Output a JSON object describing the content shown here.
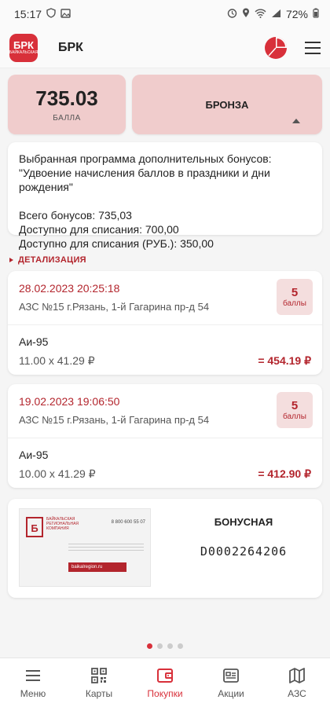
{
  "status_bar": {
    "time": "15:17",
    "battery": "72%"
  },
  "app": {
    "logo_text": "БРК",
    "logo_sub": "БАЙКАЛЬСКАЯ",
    "title": "БРК"
  },
  "points": {
    "value": "735.03",
    "label": "БАЛЛА"
  },
  "level": {
    "name": "БРОНЗА"
  },
  "info": {
    "program_line1": "Выбранная программа дополнительных бонусов:",
    "program_line2": "\"Удвоение начисления баллов в праздники и дни рождения\"",
    "total": "Всего бонусов: 735,03",
    "available": "Доступно для списания: 700,00",
    "available_rub": "Доступно для списания (РУБ.): 350,00"
  },
  "section_title": "ДЕТАЛИЗАЦИЯ",
  "transactions": [
    {
      "datetime": "28.02.2023 20:25:18",
      "station": "АЗС №15  г.Рязань, 1-й Гагарина пр-д 54",
      "points": "5",
      "points_unit": "баллы",
      "fuel": "Аи-95",
      "calc": "11.00 х 41.29 ₽",
      "total": "= 454.19 ₽"
    },
    {
      "datetime": "19.02.2023 19:06:50",
      "station": "АЗС №15  г.Рязань, 1-й Гагарина пр-д 54",
      "points": "5",
      "points_unit": "баллы",
      "fuel": "Аи-95",
      "calc": "10.00 х 41.29 ₽",
      "total": "= 412.90 ₽"
    }
  ],
  "bonus_card": {
    "type": "БОНУСНАЯ",
    "number": "D0002264206",
    "image_phone": "8 800 600 55 07",
    "image_url": "baikalregion.ru",
    "image_company": "БАЙКАЛЬСКАЯ РЕГИОНАЛЬНАЯ КОМПАНИЯ"
  },
  "carousel": {
    "count": 4,
    "active_index": 0
  },
  "nav": [
    {
      "label": "Меню",
      "icon": "menu-icon",
      "active": false
    },
    {
      "label": "Карты",
      "icon": "qr-icon",
      "active": false
    },
    {
      "label": "Покупки",
      "icon": "wallet-icon",
      "active": true
    },
    {
      "label": "Акции",
      "icon": "promo-icon",
      "active": false
    },
    {
      "label": "АЗС",
      "icon": "map-icon",
      "active": false
    }
  ],
  "colors": {
    "accent": "#d8303a",
    "accent_dark": "#b3252d",
    "card_pink": "#f0cccc"
  }
}
